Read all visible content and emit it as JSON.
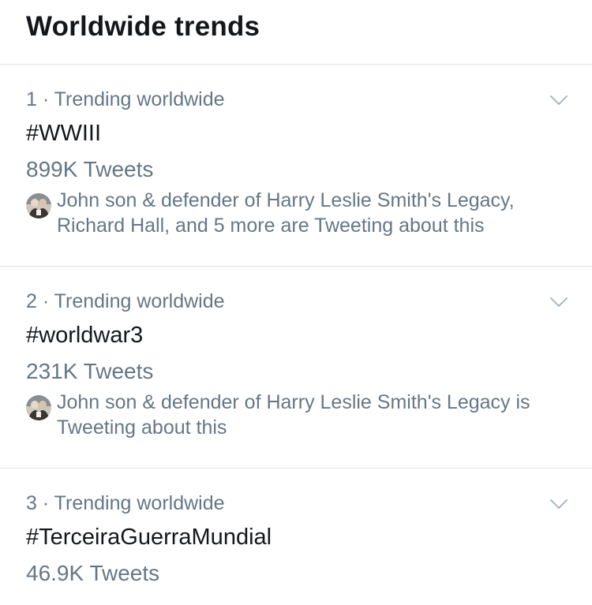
{
  "header": {
    "title": "Worldwide trends"
  },
  "trends": [
    {
      "meta": "1 · Trending worldwide",
      "hashtag": "#WWIII",
      "count": "899K Tweets",
      "context": "John son & defender of Harry Leslie Smith's Legacy, Richard Hall, and 5 more are Tweeting about this"
    },
    {
      "meta": "2 · Trending worldwide",
      "hashtag": "#worldwar3",
      "count": "231K Tweets",
      "context": "John son & defender of Harry Leslie Smith's Legacy is Tweeting about this"
    },
    {
      "meta": "3 · Trending worldwide",
      "hashtag": "#TerceiraGuerraMundial",
      "count": "46.9K Tweets"
    }
  ],
  "icons": {
    "chevron": "chevron-down-icon",
    "avatar": "avatar"
  },
  "colors": {
    "primary_text": "#14171a",
    "secondary_text": "#657786",
    "divider": "#e1e5e8",
    "chevron": "#aab8c2"
  }
}
